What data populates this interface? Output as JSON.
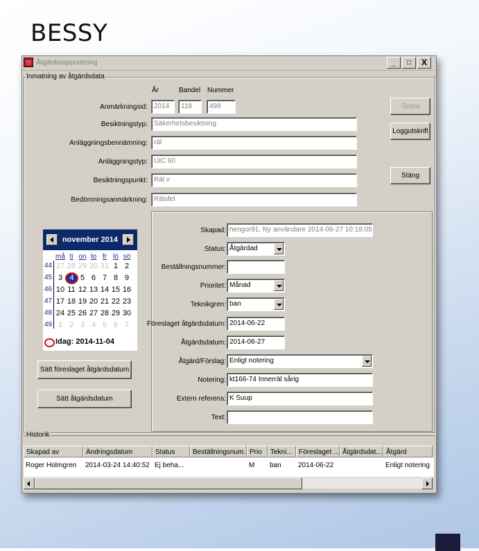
{
  "brand": "BESSY",
  "window": {
    "title": "Åtgärdsrapportering",
    "controls": {
      "minimize": "_",
      "maximize": "□",
      "close": "X"
    }
  },
  "group_label": "Inmatning av åtgärdsdata",
  "top_headers": {
    "ar": "År",
    "bandel": "Bandel",
    "nummer": "Nummer"
  },
  "fields": {
    "anmarkningsid": {
      "label": "Anmärkningsid:",
      "ar": "2014",
      "bandel": "118",
      "nummer": "498"
    },
    "besiktningstyp": {
      "label": "Besiktningstyp:",
      "value": "Säkerhetsbesiktning"
    },
    "anlaggningsbenamning": {
      "label": "Anläggningsbennämning:",
      "value": "räl"
    },
    "anlaggningstyp": {
      "label": "Anläggningstyp:",
      "value": "UIC 60"
    },
    "besiktningspunkt": {
      "label": "Besiktningspunkt:",
      "value": "Räl v"
    },
    "bedomningsanmarkning": {
      "label": "Bedömningsanmärkning:",
      "value": "Rälsfel"
    }
  },
  "buttons": {
    "spara": "Spara",
    "loggutskrift": "Loggutskrift",
    "stang": "Stäng",
    "satt_forelaget": "Sätt föreslaget åtgärdsdatum",
    "satt_atgardsdatum": "Sätt åtgärdsdatum"
  },
  "calendar": {
    "title": "november 2014",
    "dow": [
      "må",
      "ti",
      "on",
      "to",
      "fr",
      "lö",
      "sö"
    ],
    "weeks": [
      {
        "wk": "44",
        "days": [
          "27",
          "28",
          "29",
          "30",
          "31",
          "1",
          "2"
        ],
        "other": [
          true,
          true,
          true,
          true,
          true,
          false,
          false
        ]
      },
      {
        "wk": "45",
        "days": [
          "3",
          "4",
          "5",
          "6",
          "7",
          "8",
          "9"
        ],
        "other": [
          false,
          false,
          false,
          false,
          false,
          false,
          false
        ]
      },
      {
        "wk": "46",
        "days": [
          "10",
          "11",
          "12",
          "13",
          "14",
          "15",
          "16"
        ],
        "other": [
          false,
          false,
          false,
          false,
          false,
          false,
          false
        ]
      },
      {
        "wk": "47",
        "days": [
          "17",
          "18",
          "19",
          "20",
          "21",
          "22",
          "23"
        ],
        "other": [
          false,
          false,
          false,
          false,
          false,
          false,
          false
        ]
      },
      {
        "wk": "48",
        "days": [
          "24",
          "25",
          "26",
          "27",
          "28",
          "29",
          "30"
        ],
        "other": [
          false,
          false,
          false,
          false,
          false,
          false,
          false
        ]
      },
      {
        "wk": "49",
        "days": [
          "1",
          "2",
          "3",
          "4",
          "5",
          "6",
          "7"
        ],
        "other": [
          true,
          true,
          true,
          true,
          true,
          true,
          true
        ]
      }
    ],
    "today_day": "4",
    "today_text": "Idag: 2014-11-04"
  },
  "details": {
    "skapad": {
      "label": "Skapad:",
      "value": "hengor91, Ny användare  2014-06-27 10:18:05"
    },
    "status": {
      "label": "Status:",
      "value": "Åtgärdad"
    },
    "bestallningsnummer": {
      "label": "Beställningsnummer:",
      "value": ""
    },
    "prioritet": {
      "label": "Prioritet:",
      "value": "Månad"
    },
    "teknikgren": {
      "label": "Teknikgren:",
      "value": "ban"
    },
    "forelaget_atgardsdatum": {
      "label": "Föreslaget åtgärdsdatum:",
      "value": "2014-06-22"
    },
    "atgardsdatum": {
      "label": "Åtgärdsdatum:",
      "value": "2014-06-27"
    },
    "atgard_forslag": {
      "label": "Åtgärd/Förslag:",
      "value": "Enligt notering"
    },
    "notering": {
      "label": "Notering:",
      "value": "kt166-74 Innerräl sårig"
    },
    "extern_referens": {
      "label": "Extern referens:",
      "value": "K Suup"
    },
    "text": {
      "label": "Text:",
      "value": ""
    }
  },
  "historik": {
    "label": "Historik",
    "columns": [
      "Skapad av",
      "Ändringsdatum",
      "Status",
      "Beställningsnum...",
      "Prio",
      "Tekni...",
      "Föreslaget ...",
      "Åtgärdsdat...",
      "Åtgärd"
    ],
    "rows": [
      [
        "Roger Holmgren",
        "2014-03-24 14:40:52",
        "Ej beha...",
        "",
        "M",
        "ban",
        "2014-06-22",
        "",
        "Enligt notering"
      ]
    ]
  }
}
